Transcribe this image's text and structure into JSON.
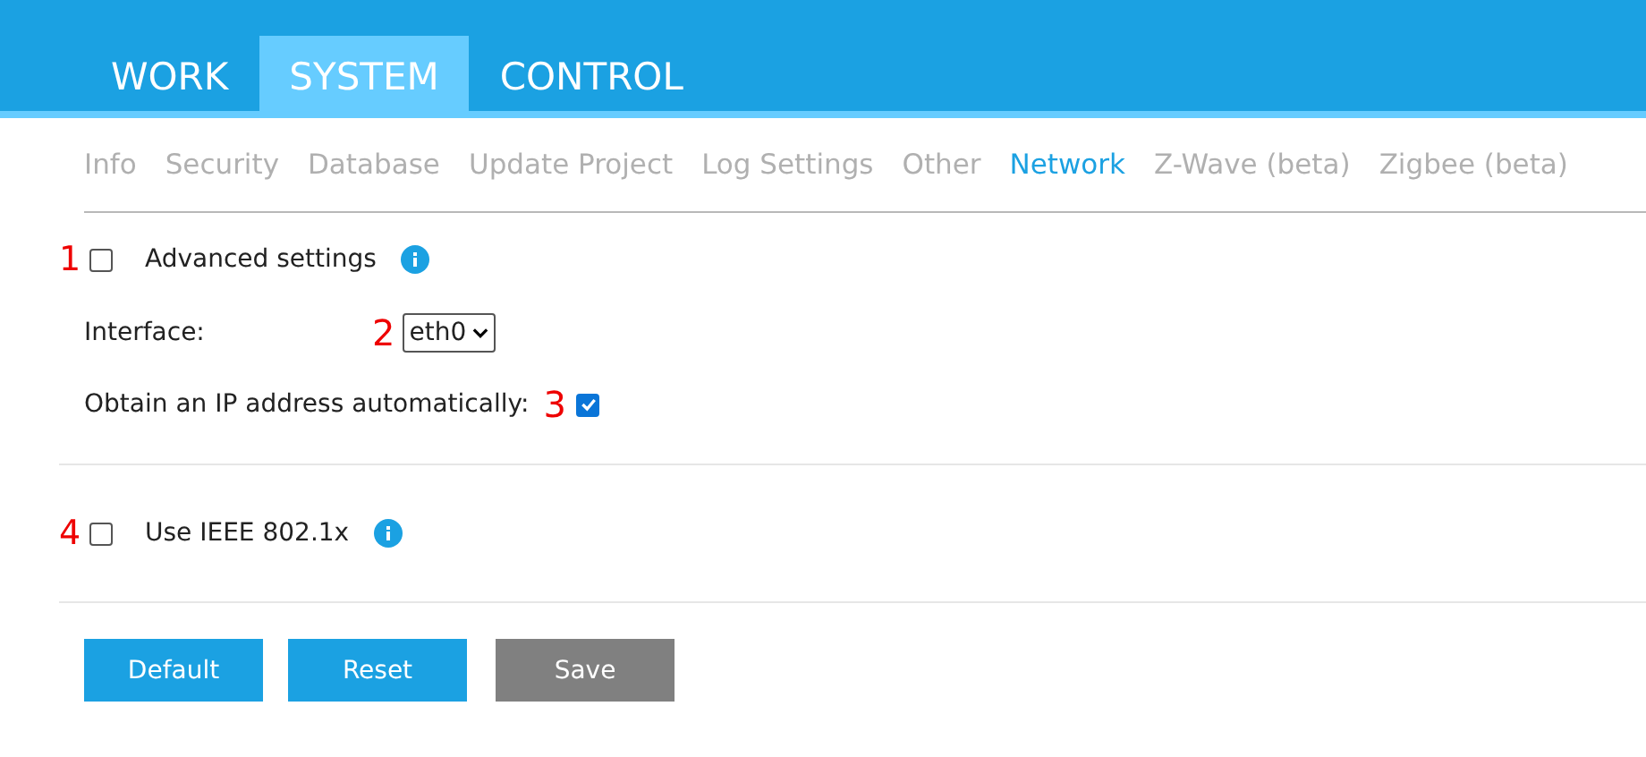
{
  "tabs": [
    {
      "label": "WORK",
      "selected": false
    },
    {
      "label": "SYSTEM",
      "selected": true
    },
    {
      "label": "CONTROL",
      "selected": false
    }
  ],
  "subtabs": [
    {
      "label": "Info",
      "selected": false
    },
    {
      "label": "Security",
      "selected": false
    },
    {
      "label": "Database",
      "selected": false
    },
    {
      "label": "Update Project",
      "selected": false
    },
    {
      "label": "Log Settings",
      "selected": false
    },
    {
      "label": "Other",
      "selected": false
    },
    {
      "label": "Network",
      "selected": true
    },
    {
      "label": "Z-Wave (beta)",
      "selected": false
    },
    {
      "label": "Zigbee (beta)",
      "selected": false
    }
  ],
  "advanced": {
    "marker": "1",
    "label": "Advanced settings",
    "checked": false
  },
  "interface": {
    "label": "Interface:",
    "marker": "2",
    "value": "eth0"
  },
  "dhcp": {
    "label": "Obtain an IP address automatically:",
    "marker": "3",
    "checked": true
  },
  "ieee": {
    "marker": "4",
    "label": "Use IEEE 802.1x",
    "checked": false
  },
  "buttons": [
    {
      "label": "Default",
      "disabled": false
    },
    {
      "label": "Reset",
      "disabled": false
    },
    {
      "label": "Save",
      "disabled": true
    }
  ]
}
